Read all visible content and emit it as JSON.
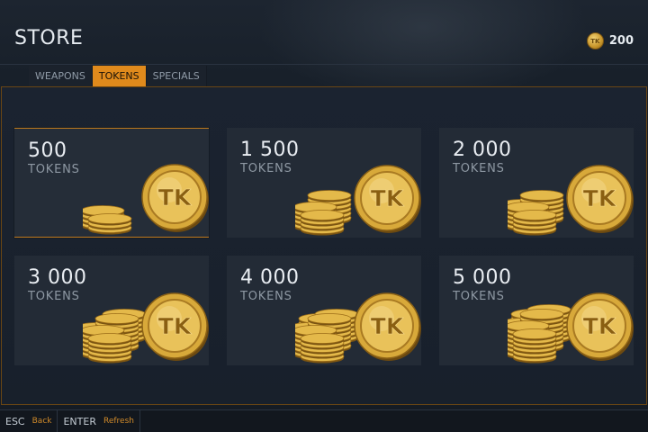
{
  "header": {
    "title": "STORE",
    "balance": {
      "icon": "token-coin-icon",
      "amount": "200"
    }
  },
  "tabs": [
    {
      "label": "WEAPONS",
      "active": false
    },
    {
      "label": "TOKENS",
      "active": true
    },
    {
      "label": "SPECIALS",
      "active": false
    }
  ],
  "packs": [
    {
      "amount": "500",
      "unit": "TOKENS",
      "stack": 1,
      "selected": true
    },
    {
      "amount": "1 500",
      "unit": "TOKENS",
      "stack": 2,
      "selected": false
    },
    {
      "amount": "2 000",
      "unit": "TOKENS",
      "stack": 3,
      "selected": false
    },
    {
      "amount": "3 000",
      "unit": "TOKENS",
      "stack": 4,
      "selected": false
    },
    {
      "amount": "4 000",
      "unit": "TOKENS",
      "stack": 5,
      "selected": false
    },
    {
      "amount": "5 000",
      "unit": "TOKENS",
      "stack": 6,
      "selected": false
    }
  ],
  "coin_label": "TK",
  "footer": {
    "back": {
      "key": "ESC",
      "action": "Back"
    },
    "refresh": {
      "key": "ENTER",
      "action": "Refresh"
    }
  },
  "colors": {
    "accent": "#e08a1c",
    "gold": "#d8a93a",
    "background": "#151b24",
    "card": "#232b36"
  }
}
